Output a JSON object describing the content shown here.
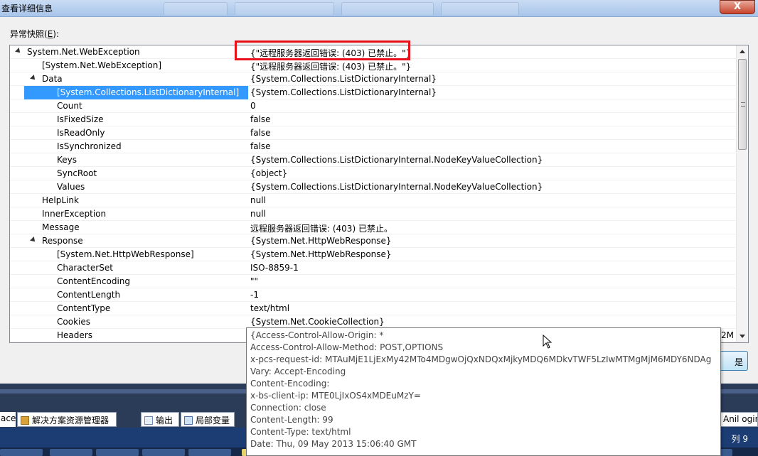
{
  "window": {
    "title": "查看详细信息",
    "close_label": "X"
  },
  "exception_snapshot_label_prefix": "异常快照(",
  "exception_snapshot_label_key": "E",
  "exception_snapshot_label_suffix": "):",
  "rows": [
    {
      "name": "System.Net.WebException",
      "value": "{\"远程服务器返回错误: (403) 已禁止。\"}",
      "level": 0,
      "expanded": true
    },
    {
      "name": "[System.Net.WebException]",
      "value": "{\"远程服务器返回错误: (403) 已禁止。\"}",
      "level": 1
    },
    {
      "name": "Data",
      "value": "{System.Collections.ListDictionaryInternal}",
      "level": 1,
      "expanded": true
    },
    {
      "name": "[System.Collections.ListDictionaryInternal]",
      "value": "{System.Collections.ListDictionaryInternal}",
      "level": 2,
      "selected": true
    },
    {
      "name": "Count",
      "value": "0",
      "level": 2
    },
    {
      "name": "IsFixedSize",
      "value": "false",
      "level": 2
    },
    {
      "name": "IsReadOnly",
      "value": "false",
      "level": 2
    },
    {
      "name": "IsSynchronized",
      "value": "false",
      "level": 2
    },
    {
      "name": "Keys",
      "value": "{System.Collections.ListDictionaryInternal.NodeKeyValueCollection}",
      "level": 2
    },
    {
      "name": "SyncRoot",
      "value": "{object}",
      "level": 2
    },
    {
      "name": "Values",
      "value": "{System.Collections.ListDictionaryInternal.NodeKeyValueCollection}",
      "level": 2
    },
    {
      "name": "HelpLink",
      "value": "null",
      "level": 1
    },
    {
      "name": "InnerException",
      "value": "null",
      "level": 1
    },
    {
      "name": "Message",
      "value": "远程服务器返回错误: (403) 已禁止。",
      "level": 1
    },
    {
      "name": "Response",
      "value": "{System.Net.HttpWebResponse}",
      "level": 1,
      "expanded": true
    },
    {
      "name": "[System.Net.HttpWebResponse]",
      "value": "{System.Net.HttpWebResponse}",
      "level": 2
    },
    {
      "name": "CharacterSet",
      "value": "ISO-8859-1",
      "level": 2
    },
    {
      "name": "ContentEncoding",
      "value": "\"\"",
      "level": 2
    },
    {
      "name": "ContentLength",
      "value": "-1",
      "level": 2
    },
    {
      "name": "ContentType",
      "value": "text/html",
      "level": 2
    },
    {
      "name": "Cookies",
      "value": "{System.Net.CookieCollection}",
      "level": 2
    },
    {
      "name": "Headers",
      "value": "2M",
      "level": 2
    }
  ],
  "tooltip_lines": [
    "{Access-Control-Allow-Origin: *",
    "Access-Control-Allow-Method: POST,OPTIONS",
    "x-pcs-request-id: MTAuMjE1LjExMy42MTo4MDgwOjQxNDQxMjkyMDQ6MDkvTWF5LzIwMTMgMjM6MDY6NDAg",
    "Vary: Accept-Encoding",
    "Content-Encoding:",
    "x-bs-client-ip: MTE0LjIxOS4xMDEuMzY=",
    "Connection: close",
    "Content-Length: 99",
    "Content-Type: text/html",
    "Date: Thu, 09 May 2013 15:06:40 GMT"
  ],
  "ide": {
    "tab_solution_prefix": "ace",
    "tab_solution": "解决方案资源管理器",
    "tab_output": "输出",
    "tab_locals": "局部变量",
    "tab_right_partial": "Anil ogin",
    "status_col": "列 9"
  },
  "ok_button_label": "是"
}
